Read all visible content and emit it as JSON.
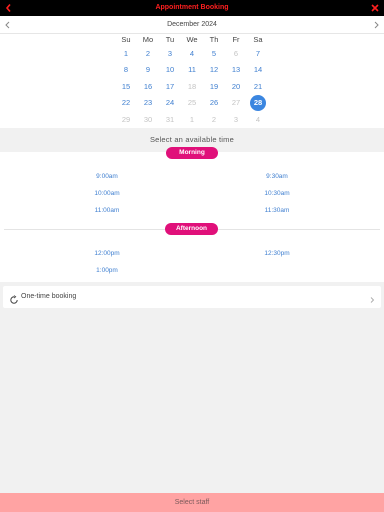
{
  "header": {
    "title": "Appointment Booking",
    "back_icon": "chevron-left-icon",
    "close_icon": "close-icon",
    "title_color": "#ff1f1f"
  },
  "calendar": {
    "month_label": "December 2024",
    "weekdays": [
      "Su",
      "Mo",
      "Tu",
      "We",
      "Th",
      "Fr",
      "Sa"
    ],
    "weeks": [
      [
        "1",
        "2",
        "3",
        "4",
        "5",
        "6",
        "7"
      ],
      [
        "8",
        "9",
        "10",
        "11",
        "12",
        "13",
        "14"
      ],
      [
        "15",
        "16",
        "17",
        "18",
        "19",
        "20",
        "21"
      ],
      [
        "22",
        "23",
        "24",
        "25",
        "26",
        "27",
        "28"
      ],
      [
        "29",
        "30",
        "31",
        "1",
        "2",
        "3",
        "4"
      ]
    ],
    "unavailable": [
      [
        0,
        5
      ],
      [
        2,
        3
      ],
      [
        3,
        3
      ],
      [
        3,
        5
      ],
      [
        4,
        0
      ],
      [
        4,
        1
      ],
      [
        4,
        2
      ],
      [
        4,
        3
      ],
      [
        4,
        4
      ],
      [
        4,
        5
      ],
      [
        4,
        6
      ]
    ],
    "selected": [
      3,
      6
    ],
    "selected_color": "#3b86e0",
    "available_color": "#3f7fd0"
  },
  "slots": {
    "heading": "Select an available time",
    "morning_label": "Morning",
    "afternoon_label": "Afternoon",
    "morning": [
      "9:00am",
      "9:30am",
      "10:00am",
      "10:30am",
      "11:00am",
      "11:30am"
    ],
    "afternoon": [
      "12:00pm",
      "12:30pm",
      "1:00pm"
    ],
    "accent": "#e0107a"
  },
  "booking": {
    "label": "One-time booking",
    "icon": "refresh-icon"
  },
  "footer": {
    "label": "Select staff",
    "color": "#ffa3a3"
  }
}
